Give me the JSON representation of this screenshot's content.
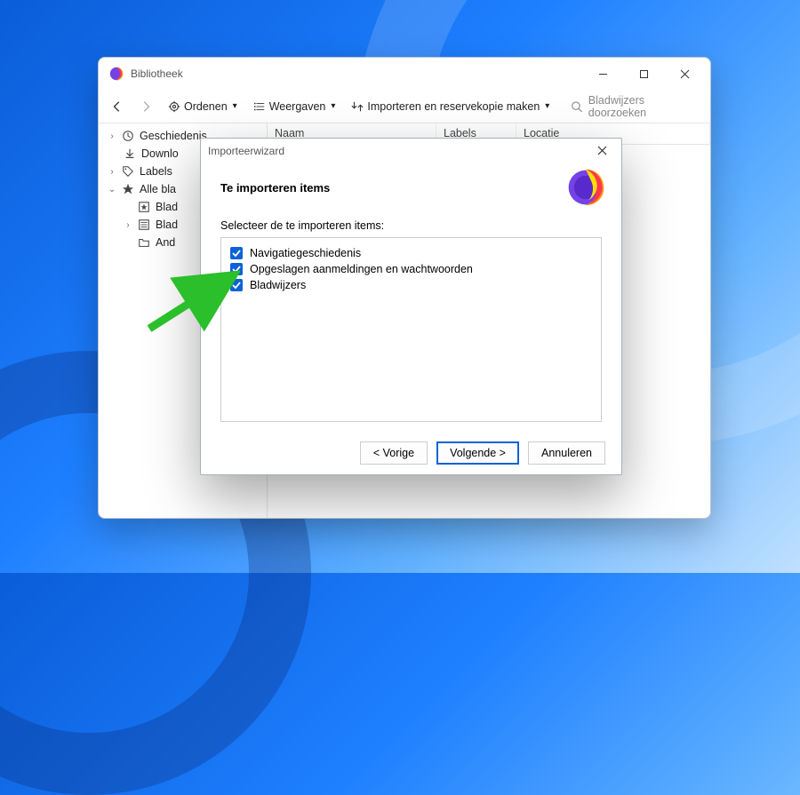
{
  "library": {
    "title": "Bibliotheek",
    "toolbar": {
      "organize": "Ordenen",
      "views": "Weergaven",
      "import": "Importeren en reservekopie maken"
    },
    "search_placeholder": "Bladwijzers doorzoeken",
    "sidebar": {
      "history": "Geschiedenis",
      "downloads": "Downlo",
      "labels": "Labels",
      "all_bookmarks": "Alle bla",
      "child_blad1": "Blad",
      "child_blad2": "Blad",
      "child_and": "And"
    },
    "columns": {
      "name": "Naam",
      "labels": "Labels",
      "location": "Locatie"
    }
  },
  "wizard": {
    "window_title": "Importeerwizard",
    "heading": "Te importeren items",
    "prompt": "Selecteer de te importeren items:",
    "items": {
      "nav_history": "Navigatiegeschiedenis",
      "saved_logins": "Opgeslagen aanmeldingen en wachtwoorden",
      "bookmarks": "Bladwijzers"
    },
    "buttons": {
      "back": "< Vorige",
      "next": "Volgende >",
      "cancel": "Annuleren"
    }
  }
}
